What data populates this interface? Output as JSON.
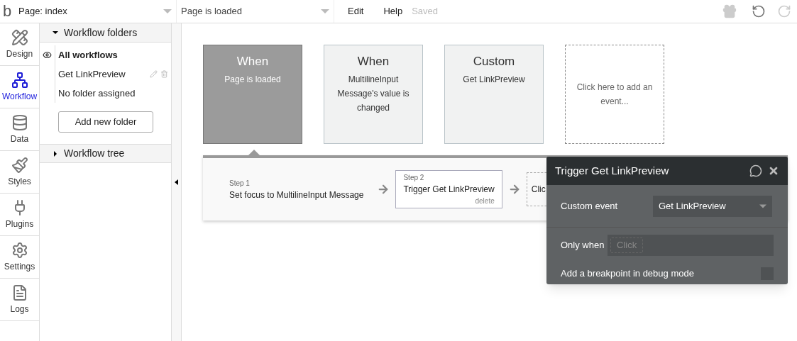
{
  "topbar": {
    "logo": "b",
    "page_select": "Page: index",
    "event_select": "Page is loaded",
    "menu": [
      "Edit",
      "Help"
    ],
    "status": "Saved"
  },
  "nav": [
    {
      "label": "Design",
      "kind": "design",
      "selected": false
    },
    {
      "label": "Workflow",
      "kind": "workflow",
      "selected": true
    },
    {
      "label": "Data",
      "kind": "data",
      "selected": false
    },
    {
      "label": "Styles",
      "kind": "styles",
      "selected": false
    },
    {
      "label": "Plugins",
      "kind": "plugins",
      "selected": false
    },
    {
      "label": "Settings",
      "kind": "settings",
      "selected": false
    },
    {
      "label": "Logs",
      "kind": "logs",
      "selected": false
    }
  ],
  "folders": {
    "title": "Workflow folders",
    "expanded": true,
    "items": [
      {
        "label": "All workflows",
        "selected": true,
        "editable": false
      },
      {
        "label": "Get LinkPreview",
        "selected": false,
        "editable": true
      },
      {
        "label": "No folder assigned",
        "selected": false,
        "editable": false
      }
    ],
    "add_button": "Add new folder"
  },
  "tree": {
    "title": "Workflow tree",
    "expanded": false
  },
  "events": [
    {
      "kind": "event",
      "title": "When",
      "subtitle": "Page is loaded",
      "selected": true
    },
    {
      "kind": "event",
      "title": "When",
      "subtitle": "MultilineInput Message's value is changed",
      "selected": false
    },
    {
      "kind": "event",
      "title": "Custom",
      "subtitle": "Get LinkPreview",
      "selected": false
    },
    {
      "kind": "add",
      "subtitle": "Click here to add an event..."
    }
  ],
  "steps": [
    {
      "kind": "step",
      "number": "Step 1",
      "action": "Set focus to MultilineInput Message",
      "selected": false
    },
    {
      "kind": "step",
      "number": "Step 2",
      "action": "Trigger Get LinkPreview",
      "selected": true,
      "delete": "delete"
    },
    {
      "kind": "add",
      "action": "Clic"
    }
  ],
  "popup": {
    "title": "Trigger Get LinkPreview",
    "custom_event_label": "Custom event",
    "custom_event_value": "Get LinkPreview",
    "only_when_label": "Only when",
    "only_when_placeholder": "Click",
    "breakpoint_label": "Add a breakpoint in debug mode",
    "breakpoint_checked": false
  }
}
